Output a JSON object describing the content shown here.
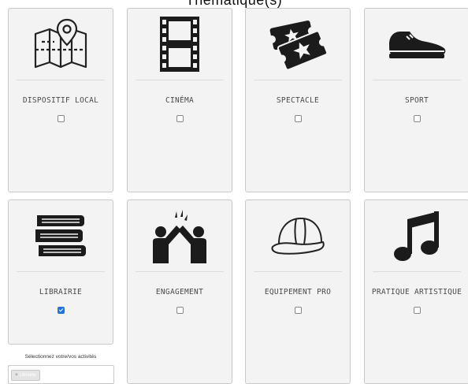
{
  "page": {
    "heading": "Thématique(s)"
  },
  "cards": [
    {
      "label": "DISPOSITIF LOCAL",
      "icon": "map-icon",
      "checked": false
    },
    {
      "label": "CINÉMA",
      "icon": "film-strip-icon",
      "checked": false
    },
    {
      "label": "SPECTACLE",
      "icon": "tickets-icon",
      "checked": false
    },
    {
      "label": "SPORT",
      "icon": "sneaker-icon",
      "checked": false
    },
    {
      "label": "LIBRAIRIE",
      "icon": "books-icon",
      "checked": true
    },
    {
      "label": "ENGAGEMENT",
      "icon": "high-five-icon",
      "checked": false
    },
    {
      "label": "EQUIPEMENT PRO",
      "icon": "hard-hat-icon",
      "checked": false
    },
    {
      "label": "PRATIQUE ARTISTIQUE",
      "icon": "music-note-icon",
      "checked": false
    }
  ],
  "activities": {
    "hint": "Sélectionnez votre/vos activités",
    "selected_tag": "Librairie",
    "remove_glyph": "×"
  }
}
